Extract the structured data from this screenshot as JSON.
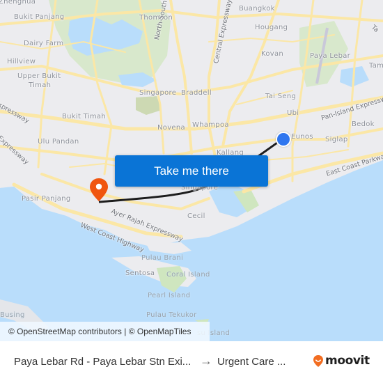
{
  "map": {
    "labels": {
      "zhenghua": "Zhenghua",
      "bukit_panjang": "Bukit Panjang",
      "thomson": "Thomson",
      "buangkok": "Buangkok",
      "hougang": "Hougang",
      "dairy_farm": "Dairy Farm",
      "hillview": "Hillview",
      "upper_bukit": "Upper Bukit",
      "timah": "Timah",
      "kovan": "Kovan",
      "paya_lebar": "Paya Lebar",
      "tam": "Tam",
      "ta": "Ta",
      "singapore_top": "Singapore",
      "braddell": "Braddell",
      "tai_seng": "Tai Seng",
      "ubi": "Ubi",
      "bukit_timah": "Bukit Timah",
      "novena": "Novena",
      "whampoa": "Whampoa",
      "bedok": "Bedok",
      "eunos": "Eunos",
      "siglap": "Siglap",
      "ulu_pandan": "Ulu Pandan",
      "kallang": "Kallang",
      "singapore_center": "Singapore",
      "pasir_panjang": "Pasir Panjang",
      "cecil": "Cecil",
      "pulau_brani": "Pulau Brani",
      "sentosa": "Sentosa",
      "coral_island": "Coral Island",
      "pearl_island": "Pearl Island",
      "busing": "Busing",
      "pulau_tekukor": "Pulau Tekukor",
      "su_island": "su Island"
    },
    "roads": {
      "north_south_expressway": "North-South Expressway",
      "central_expressway": "Central Expressway",
      "pan_island_expressway": "Pan-Island Expressway",
      "east_coast_parkway": "East Coast Parkway",
      "ayer_rajah_expressway": "Ayer Rajah Expressway",
      "west_coast_highway": "West Coast Highway",
      "expressway_nw": "Expressway",
      "expressway_w": "a Expressway"
    },
    "attribution": "© OpenStreetMap contributors | © OpenMapTiles",
    "cta_label": "Take me there",
    "origin_marker": "Paya Lebar Rd - Paya Lebar Stn Exit",
    "destination_marker": "Urgent Care",
    "colors": {
      "water": "#b9ddfb",
      "land": "#ececef",
      "park": "#d4e6c3",
      "road": "#fbe7a6",
      "route": "#1d1d1d",
      "cta": "#0a74d6",
      "origin": "#2f76ef",
      "destination": "#f0550f"
    }
  },
  "footer": {
    "from": "Paya Lebar Rd - Paya Lebar Stn Exi...",
    "arrow": "→",
    "to": "Urgent Care ...",
    "brand": "moovit",
    "brand_color": "#f26d21"
  }
}
